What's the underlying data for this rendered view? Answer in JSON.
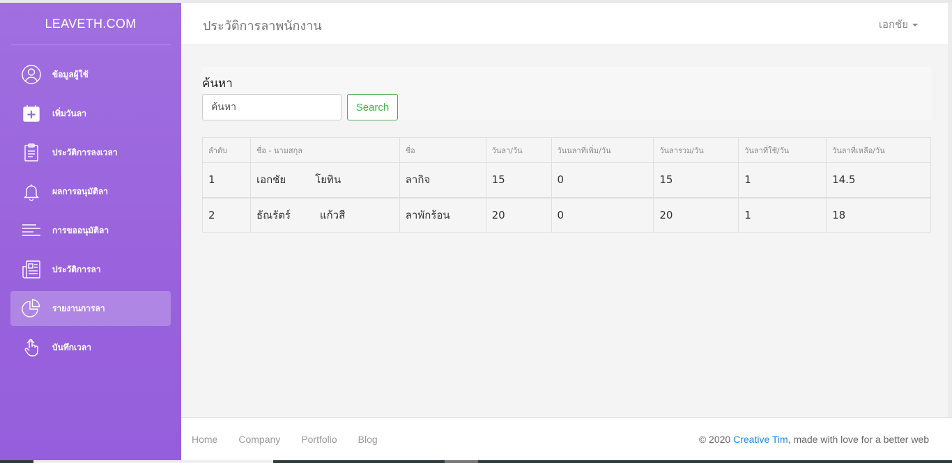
{
  "brand": "LEAVETH.COM",
  "header": {
    "title": "ประวัติการลาพนักงาน",
    "user": "เอกชัย"
  },
  "sidebar": {
    "items": [
      {
        "label": "ข้อมูลผู้ใช้",
        "icon": "user-circle-icon"
      },
      {
        "label": "เพิ่มวันลา",
        "icon": "calendar-plus-icon"
      },
      {
        "label": "ประวัติการลงเวลา",
        "icon": "clipboard-icon"
      },
      {
        "label": "ผลการอนุมัติลา",
        "icon": "bell-icon"
      },
      {
        "label": "การขออนุมัติลา",
        "icon": "text-lines-icon"
      },
      {
        "label": "ประวัติการลา",
        "icon": "newspaper-icon"
      },
      {
        "label": "รายงานการลา",
        "icon": "pie-chart-icon",
        "active": true
      },
      {
        "label": "บันทึกเวลา",
        "icon": "hand-pointer-icon"
      }
    ]
  },
  "search": {
    "title": "ค้นหา",
    "placeholder": "ค้นหา",
    "button": "Search"
  },
  "table": {
    "headers": [
      "ลำดับ",
      "ชื่อ - นามสกุล",
      "ชื่อ",
      "วันลา/วัน",
      "วันนลาที่เพิ่ม/วัน",
      "วันลารวม/วัน",
      "วันลาที่ใช้/วัน",
      "วันลาที่เหลือ/วัน"
    ],
    "rows": [
      {
        "no": "1",
        "first": "เอกชัย",
        "last": "โยทิน",
        "type": "ลากิจ",
        "days": "15",
        "added": "0",
        "total": "15",
        "used": "1",
        "remaining": "14.5"
      },
      {
        "no": "2",
        "first": "ธัณรัตร์",
        "last": "แก้วสี",
        "type": "ลาพักร้อน",
        "days": "20",
        "added": "0",
        "total": "20",
        "used": "1",
        "remaining": "18"
      }
    ]
  },
  "footer": {
    "links": [
      "Home",
      "Company",
      "Portfolio",
      "Blog"
    ],
    "copyright_prefix": "© 2020 ",
    "copyright_link": "Creative Tim",
    "copyright_suffix": ", made with love for a better web"
  },
  "colors": {
    "sidebar_top": "#a06fe0",
    "sidebar_bottom": "#955edc",
    "success": "#4caf50",
    "link": "#1e88e5"
  }
}
